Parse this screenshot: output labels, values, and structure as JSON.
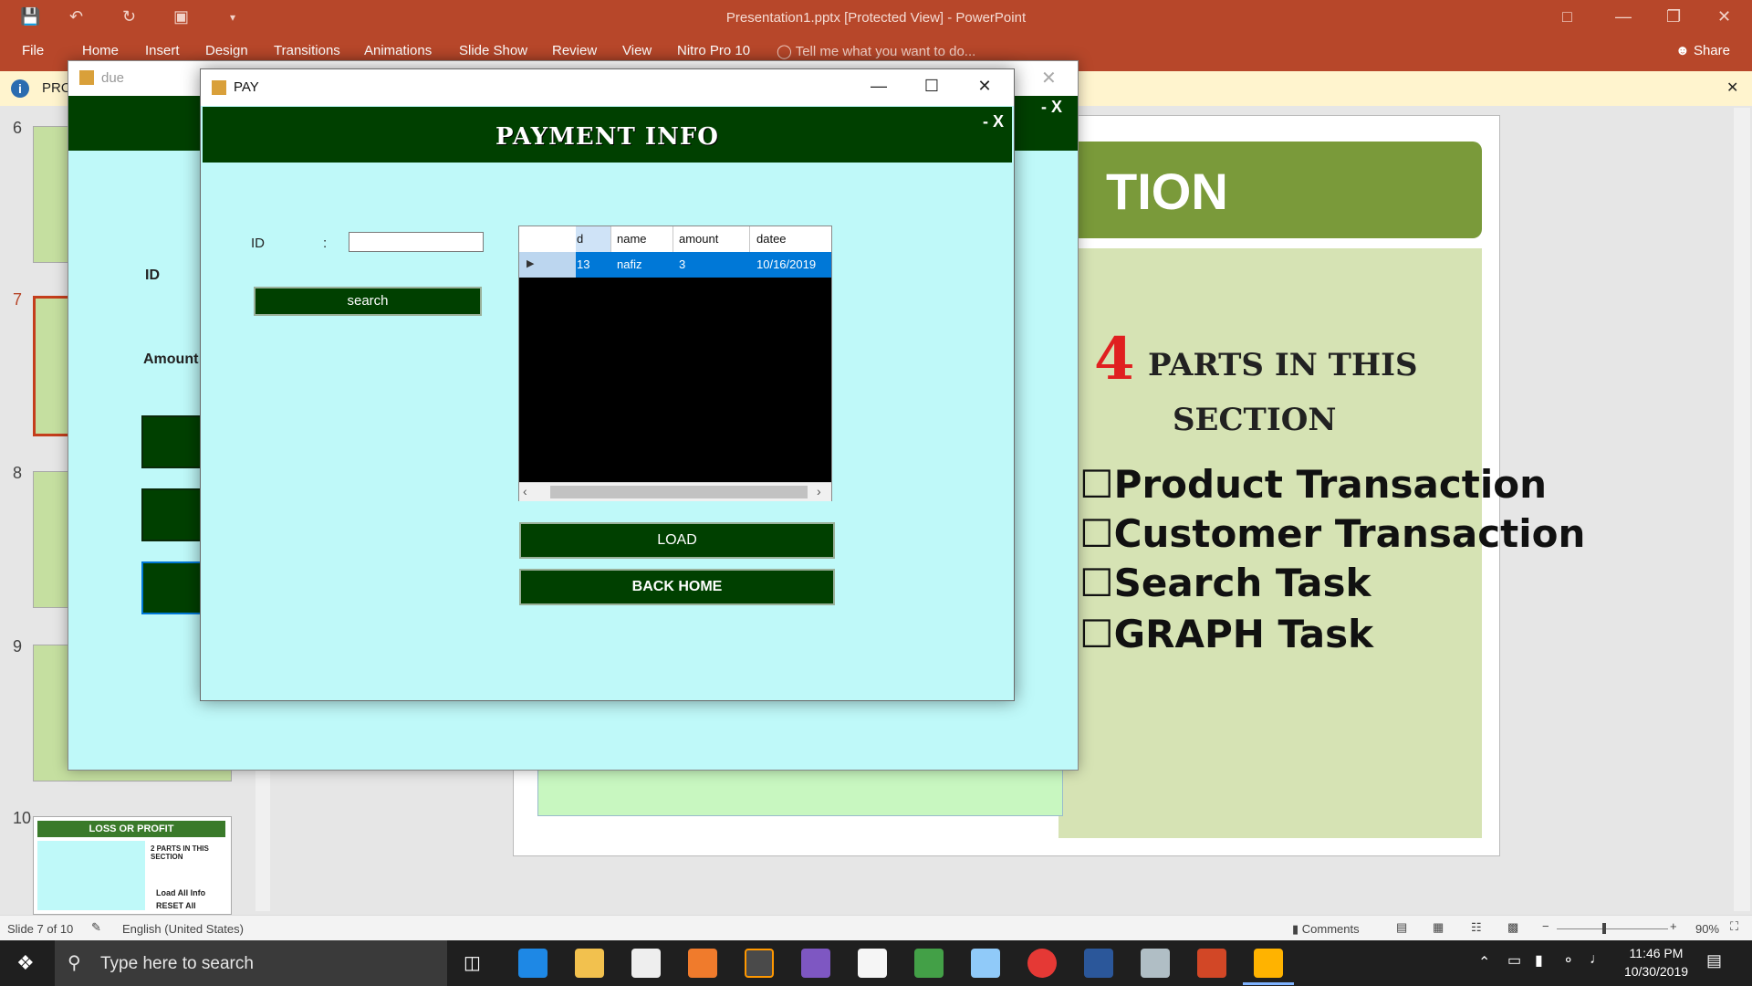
{
  "powerpoint": {
    "title": "Presentation1.pptx [Protected View] - PowerPoint",
    "tabs": [
      "File",
      "Home",
      "Insert",
      "Design",
      "Transitions",
      "Animations",
      "Slide Show",
      "Review",
      "View",
      "Nitro Pro 10"
    ],
    "tell_me": "Tell me what you want to do...",
    "share": "Share",
    "protected_label": "PRO",
    "slide_numbers": [
      "6",
      "7",
      "8",
      "9",
      "10"
    ],
    "thumb10_title": "LOSS OR PROFIT",
    "thumb10_parts": "2 PARTS IN THIS SECTION",
    "thumb10_b1": "Load All Info",
    "thumb10_b2": "RESET All",
    "status_slide": "Slide 7 of 10",
    "status_lang": "English (United States)",
    "status_comments": "Comments",
    "zoom": "90%",
    "slide": {
      "banner_text": "TION",
      "count": "4",
      "parts_text": "PARTS IN THIS",
      "section_text": "SECTION",
      "bullets": [
        "Product Transaction",
        "Customer Transaction",
        "Search Task",
        "GRAPH Task"
      ]
    }
  },
  "due_window": {
    "title": "due",
    "close_glyph": "- X",
    "id_label": "ID",
    "amount_label": "Amount"
  },
  "pay_window": {
    "title": "PAY",
    "heading": "PAYMENT INFO",
    "close_glyph": "- X",
    "id_label": "ID",
    "colon": ":",
    "id_value": "",
    "search_label": "search",
    "load_label": "LOAD",
    "back_label": "BACK HOME",
    "grid": {
      "columns": [
        "d",
        "name",
        "amount",
        "datee"
      ],
      "rows": [
        [
          "13",
          "nafiz",
          "3",
          "10/16/2019"
        ]
      ]
    }
  },
  "taskbar": {
    "search_placeholder": "Type here to search",
    "time": "11:46 PM",
    "date": "10/30/2019"
  },
  "colors": {
    "ppt_red": "#b7472a",
    "form_bg": "#bff9f9",
    "form_green": "#004000",
    "selection_blue": "#0078d7"
  }
}
